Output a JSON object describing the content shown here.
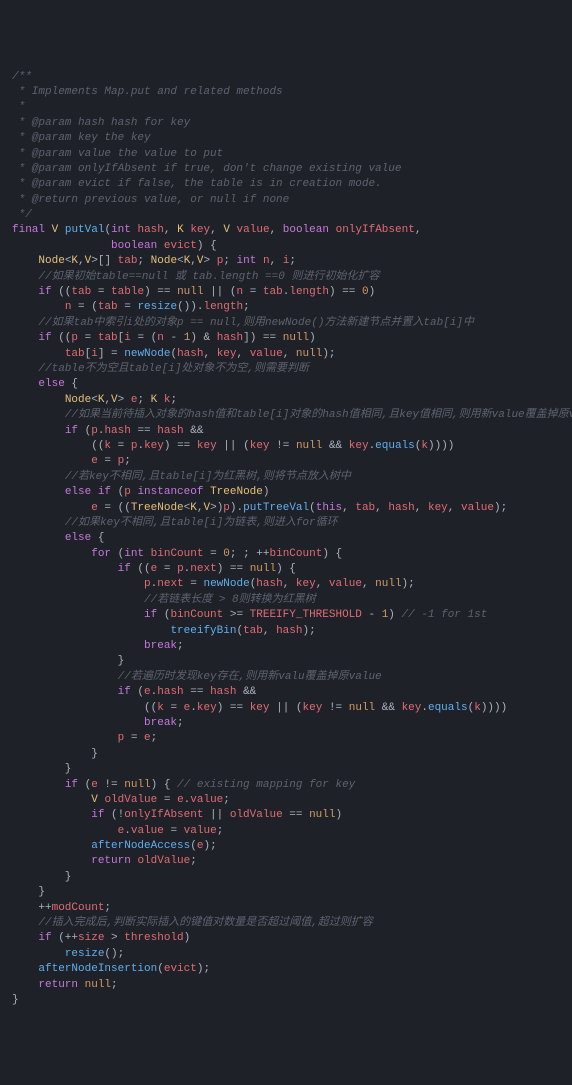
{
  "doc": {
    "l1": "/**",
    "l2": " * Implements Map.put and related methods",
    "l3": " *",
    "l4": " * @param hash hash for key",
    "l5": " * @param key the key",
    "l6": " * @param value the value to put",
    "l7": " * @param onlyIfAbsent if true, don't change existing value",
    "l8": " * @param evict if false, the table is in creation mode.",
    "l9": " * @return previous value, or null if none",
    "l10": " */"
  },
  "kw": {
    "final": "final",
    "int": "int",
    "boolean": "boolean",
    "if": "if",
    "else": "else",
    "for": "for",
    "return": "return",
    "break": "break",
    "null": "null",
    "this": "this",
    "instanceof": "instanceof"
  },
  "ty": {
    "V": "V",
    "K": "K",
    "Node": "Node",
    "TreeNode": "TreeNode"
  },
  "fn": {
    "putVal": "putVal",
    "resize": "resize",
    "newNode": "newNode",
    "putTreeVal": "putTreeVal",
    "equals": "equals",
    "treeifyBin": "treeifyBin",
    "afterNodeAccess": "afterNodeAccess",
    "afterNodeInsertion": "afterNodeInsertion"
  },
  "id": {
    "hash": "hash",
    "key": "key",
    "value": "value",
    "onlyIfAbsent": "onlyIfAbsent",
    "evict": "evict",
    "tab": "tab",
    "p": "p",
    "n": "n",
    "i": "i",
    "table": "table",
    "length": "length",
    "e": "e",
    "k": "k",
    "next": "next",
    "binCount": "binCount",
    "TREEIFY_THRESHOLD": "TREEIFY_THRESHOLD",
    "oldValue": "oldValue",
    "modCount": "modCount",
    "size": "size",
    "threshold": "threshold"
  },
  "num": {
    "zero": "0",
    "one": "1",
    "eight": "8"
  },
  "cm": {
    "c1": "//如果初始table==null 或 tab.length ==0 则进行初始化扩容",
    "c2": "//如果tab中索引i处的对象p == null,则用newNode()方法新建节点并置入tab[i]中",
    "c3": "//table不为空且table[i]处对象不为空,则需要判断",
    "c4": "//如果当前待插入对象的hash值和table[i]对象的hash值相同,且key值相同,则用新value覆盖掉原value",
    "c5": "//若key不相同,且table[i]为红黑树,则将节点放入树中",
    "c6": "//如果key不相同,且table[i]为链表,则进入for循环",
    "c7": "//若链表长度 > 8则转换为红黑树",
    "c8": "// -1 for 1st",
    "c9": "//若遍历时发现key存在,则用新valu覆盖掉原value",
    "c10": "// existing mapping for key",
    "c11": "//插入完成后,判断实际插入的键值对数量是否超过阈值,超过则扩容"
  }
}
